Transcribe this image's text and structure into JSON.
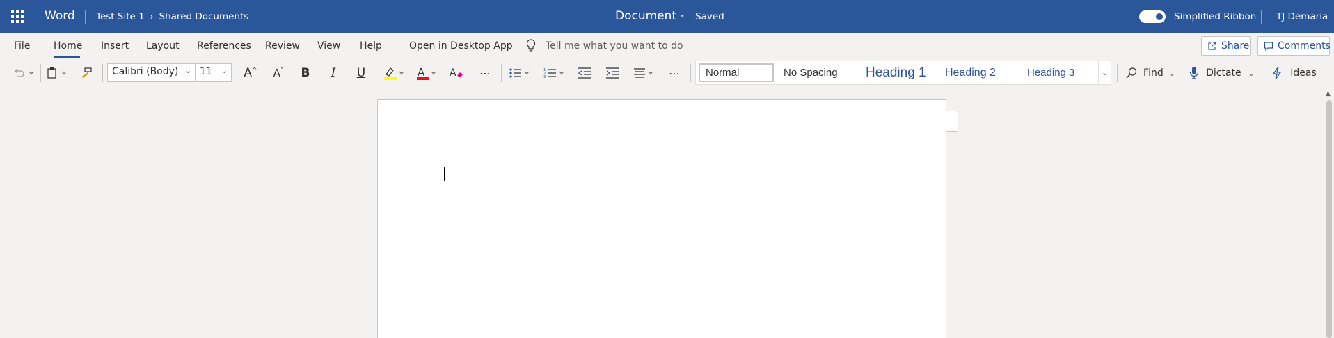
{
  "titlebar": {
    "app_name": "Word",
    "breadcrumb": [
      "Test Site 1",
      "Shared Documents"
    ],
    "doc_title": "Document",
    "separator": "-",
    "save_status": "Saved",
    "simplified_ribbon_label": "Simplified Ribbon",
    "simplified_ribbon_on": true,
    "user_name": "TJ Demaria",
    "bg_color": "#2b579a"
  },
  "tabs": {
    "items": [
      "File",
      "Home",
      "Insert",
      "Layout",
      "References",
      "Review",
      "View",
      "Help"
    ],
    "active": "Home",
    "open_desktop": "Open in Desktop App",
    "tell_me": "Tell me what you want to do",
    "share": "Share",
    "comments": "Comments"
  },
  "ribbon": {
    "font_name": "Calibri (Body)",
    "font_size": "11",
    "styles": [
      "Normal",
      "No Spacing",
      "Heading 1",
      "Heading 2",
      "Heading 3"
    ],
    "selected_style": "Normal",
    "find": "Find",
    "dictate": "Dictate",
    "ideas": "Ideas",
    "highlight_color": "#ffff00",
    "font_color": "#e81123"
  },
  "icons": [
    "waffle-icon",
    "chevron-right-icon",
    "lightbulb-icon",
    "share-icon",
    "comment-icon",
    "undo-icon",
    "clipboard-icon",
    "format-painter-icon",
    "grow-font-icon",
    "shrink-font-icon",
    "bold-icon",
    "italic-icon",
    "underline-icon",
    "highlight-icon",
    "font-color-icon",
    "clear-format-icon",
    "more-icon",
    "bullets-icon",
    "numbering-icon",
    "decrease-indent-icon",
    "increase-indent-icon",
    "align-icon",
    "search-icon",
    "microphone-icon",
    "lightning-icon"
  ]
}
